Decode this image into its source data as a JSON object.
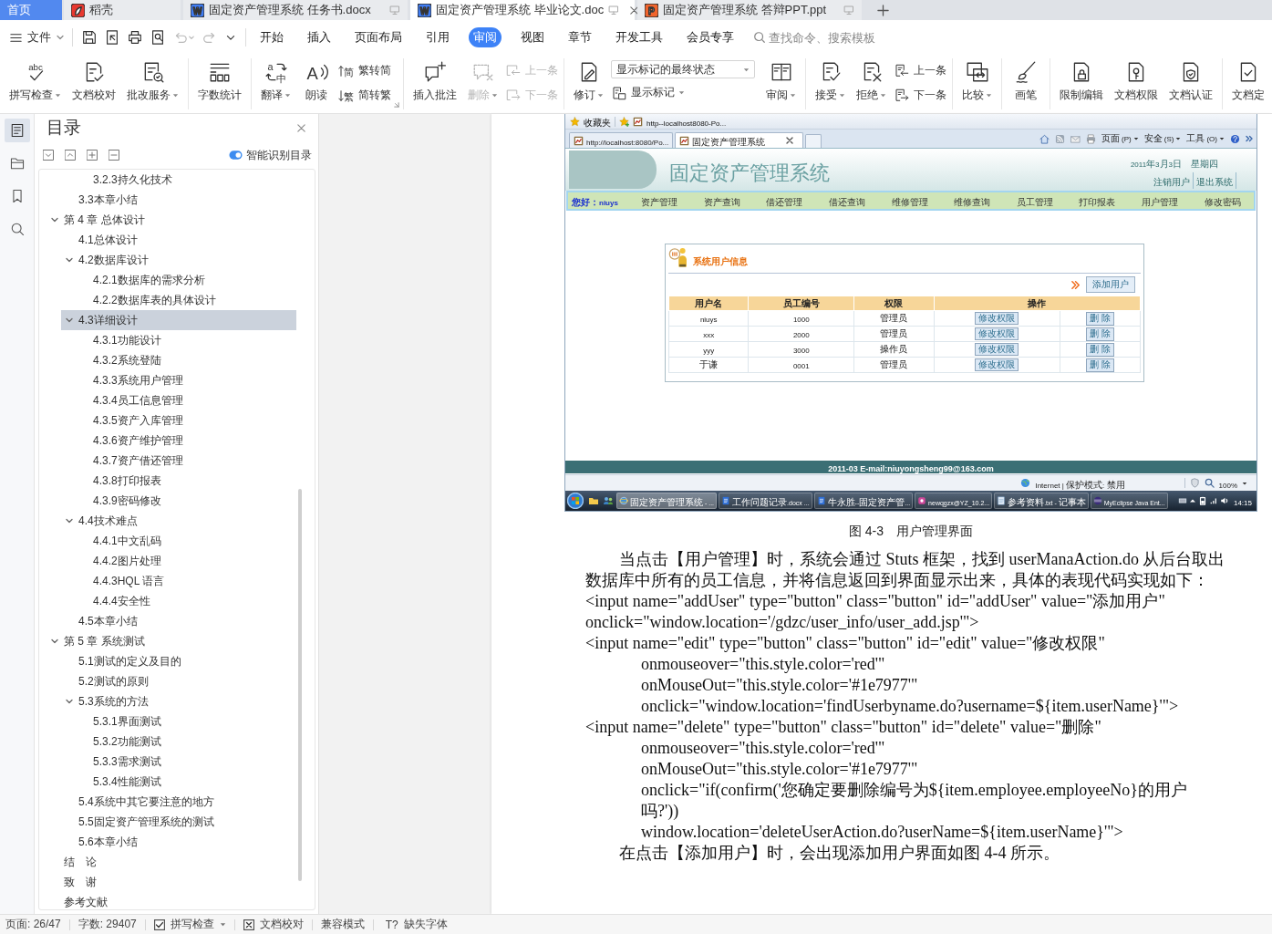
{
  "tabs": [
    {
      "label": "首页",
      "kind": "home",
      "selected": false
    },
    {
      "label": "稻壳",
      "kind": "docer",
      "selected": false
    },
    {
      "label": "固定资产管理系统 任务书.docx",
      "kind": "writer",
      "icon_text": "W",
      "selected": false
    },
    {
      "label": "固定资产管理系统 毕业论文.doc",
      "kind": "writer",
      "icon_text": "W",
      "selected": true
    },
    {
      "label": "固定资产管理系统 答辩PPT.ppt",
      "kind": "presentation",
      "icon_text": "P",
      "selected": false
    }
  ],
  "menu_bar": {
    "file_menu": "文件",
    "quick_access": [
      {
        "disabled": false
      },
      {
        "disabled": false
      },
      {
        "disabled": false
      },
      {
        "disabled": false
      },
      {
        "disabled": true
      },
      {
        "disabled": true
      }
    ],
    "menus": [
      {
        "label": "开始",
        "selected": false
      },
      {
        "label": "插入",
        "selected": false
      },
      {
        "label": "页面布局",
        "selected": false
      },
      {
        "label": "引用",
        "selected": false
      },
      {
        "label": "审阅",
        "selected": true
      },
      {
        "label": "视图",
        "selected": false
      },
      {
        "label": "章节",
        "selected": false
      },
      {
        "label": "开发工具",
        "selected": false
      },
      {
        "label": "会员专享",
        "selected": false
      }
    ],
    "search": {
      "placeholder": "查找命令、搜索模板"
    }
  },
  "ribbon": {
    "groups": [
      {
        "launcher": false,
        "items": [
          {
            "kind": "large",
            "label": "拼写检查",
            "glyphs": [
              "abc"
            ],
            "dropdown": true,
            "disabled": false
          },
          {
            "kind": "large",
            "label": "文档校对",
            "dropdown": false,
            "disabled": false
          },
          {
            "kind": "large",
            "label": "批改服务",
            "dropdown": true,
            "disabled": false
          }
        ]
      },
      {
        "launcher": false,
        "items": [
          {
            "kind": "large",
            "label": "字数统计",
            "dropdown": false,
            "disabled": false
          }
        ]
      },
      {
        "launcher": true,
        "items": [
          {
            "kind": "large",
            "label": "翻译",
            "glyphs": [
              "a",
              "中"
            ],
            "dropdown": true,
            "disabled": false
          },
          {
            "kind": "large",
            "label": "朗读",
            "glyphs": [
              "A"
            ],
            "dropdown": false,
            "disabled": false
          },
          {
            "kind": "stack",
            "buttons": [
              {
                "label": "繁转简",
                "glyphs": [
                  "简"
                ],
                "disabled": false
              },
              {
                "label": "简转繁",
                "glyphs": [
                  "繁"
                ],
                "disabled": false
              }
            ]
          }
        ]
      },
      {
        "launcher": false,
        "items": [
          {
            "kind": "large",
            "label": "插入批注",
            "dropdown": false,
            "disabled": false
          },
          {
            "kind": "large",
            "label": "删除",
            "dropdown": true,
            "disabled": true
          },
          {
            "kind": "stack",
            "buttons": [
              {
                "label": "上一条",
                "disabled": true
              },
              {
                "label": "下一条",
                "disabled": true
              }
            ]
          }
        ]
      },
      {
        "launcher": false,
        "items": [
          {
            "kind": "large",
            "label": "修订",
            "dropdown": true,
            "disabled": false
          },
          {
            "kind": "select",
            "value": "显示标记的最终状态",
            "button": {
              "label": "显示标记",
              "dropdown": true,
              "disabled": false
            }
          },
          {
            "kind": "large",
            "label": "审阅",
            "dropdown": true,
            "disabled": false
          }
        ]
      },
      {
        "launcher": false,
        "items": [
          {
            "kind": "large",
            "label": "接受",
            "dropdown": true,
            "disabled": false
          },
          {
            "kind": "large",
            "label": "拒绝",
            "dropdown": true,
            "disabled": false
          },
          {
            "kind": "stack",
            "buttons": [
              {
                "label": "上一条",
                "disabled": false
              },
              {
                "label": "下一条",
                "disabled": false
              }
            ]
          }
        ]
      },
      {
        "launcher": false,
        "items": [
          {
            "kind": "large",
            "label": "比较",
            "dropdown": true,
            "disabled": false
          }
        ]
      },
      {
        "launcher": false,
        "items": [
          {
            "kind": "large",
            "label": "画笔",
            "dropdown": false,
            "disabled": false
          }
        ]
      },
      {
        "launcher": false,
        "items": [
          {
            "kind": "large",
            "label": "限制编辑",
            "dropdown": false,
            "disabled": false
          },
          {
            "kind": "large",
            "label": "文档权限",
            "dropdown": false,
            "disabled": false
          },
          {
            "kind": "large",
            "label": "文档认证",
            "dropdown": false,
            "disabled": false
          }
        ]
      },
      {
        "launcher": false,
        "items": [
          {
            "kind": "large",
            "label": "文档定",
            "dropdown": false,
            "disabled": false
          }
        ]
      }
    ]
  },
  "nav_rail": [
    {
      "selected": true
    },
    {
      "selected": false
    },
    {
      "selected": false
    },
    {
      "selected": false
    }
  ],
  "toc": {
    "title": "目录",
    "smart_button": "智能识别目录",
    "items": [
      {
        "children": [
          {
            "children": [
              {
                "label": "3.2.3持久化技术",
                "selected": false
              }
            ]
          },
          {
            "label": "3.3本章小结",
            "selected": false
          }
        ]
      },
      {
        "label": "第 4 章 总体设计",
        "selected": false,
        "expanded": true,
        "children": [
          {
            "label": "4.1总体设计",
            "selected": false
          },
          {
            "label": "4.2数据库设计",
            "selected": false,
            "expanded": true,
            "children": [
              {
                "label": "4.2.1数据库的需求分析",
                "selected": false
              },
              {
                "label": "4.2.2数据库表的具体设计",
                "selected": false
              }
            ]
          },
          {
            "label": "4.3详细设计",
            "selected": true,
            "expanded": true,
            "children": [
              {
                "label": "4.3.1功能设计",
                "selected": false
              },
              {
                "label": "4.3.2系统登陆",
                "selected": false
              },
              {
                "label": "4.3.3系统用户管理",
                "selected": false
              },
              {
                "label": "4.3.4员工信息管理",
                "selected": false
              },
              {
                "label": "4.3.5资产入库管理",
                "selected": false
              },
              {
                "label": "4.3.6资产维护管理",
                "selected": false
              },
              {
                "label": "4.3.7资产借还管理",
                "selected": false
              },
              {
                "label": "4.3.8打印报表",
                "selected": false
              },
              {
                "label": "4.3.9密码修改",
                "selected": false
              }
            ]
          },
          {
            "label": "4.4技术难点",
            "selected": false,
            "expanded": true,
            "children": [
              {
                "label": "4.4.1中文乱码",
                "selected": false
              },
              {
                "label": "4.4.2图片处理",
                "selected": false
              },
              {
                "label": "4.4.3HQL 语言",
                "selected": false
              },
              {
                "label": "4.4.4安全性",
                "selected": false
              }
            ]
          },
          {
            "label": "4.5本章小结",
            "selected": false
          }
        ]
      },
      {
        "label": "第 5 章 系统测试",
        "selected": false,
        "expanded": true,
        "children": [
          {
            "label": "5.1测试的定义及目的",
            "selected": false
          },
          {
            "label": "5.2测试的原则",
            "selected": false
          },
          {
            "label": "5.3系统的方法",
            "selected": false,
            "expanded": true,
            "children": [
              {
                "label": "5.3.1界面测试",
                "selected": false
              },
              {
                "label": "5.3.2功能测试",
                "selected": false
              },
              {
                "label": "5.3.3需求测试",
                "selected": false
              },
              {
                "label": "5.3.4性能测试",
                "selected": false
              }
            ]
          },
          {
            "label": "5.4系统中其它要注意的地方",
            "selected": false
          },
          {
            "label": "5.5固定资产管理系统的测试",
            "selected": false
          },
          {
            "label": "5.6本章小结",
            "selected": false
          }
        ]
      },
      {
        "label": "结　论",
        "selected": false
      },
      {
        "label": "致　谢",
        "selected": false
      },
      {
        "label": "参考文献",
        "selected": false
      }
    ]
  },
  "document": {
    "figure": {
      "favorites": {
        "label": "收藏夹",
        "link": "http--localhost8080-Po..."
      },
      "browser_tabs": [
        {
          "label": "http://localhost:8080/Po...",
          "selected": false
        },
        {
          "label": "固定资产管理系统",
          "selected": true
        }
      ],
      "command_menus": [
        "页面(P)",
        "安全(S)",
        "工具(O)"
      ],
      "site": {
        "title": "固定资产管理系统",
        "date": "2011年3月3日",
        "weekday": "星期四",
        "links": [
          "注销用户",
          "退出系统"
        ],
        "greeting": "您好：niuys",
        "nav": [
          "资产管理",
          "资产查询",
          "借还管理",
          "借还查询",
          "维修管理",
          "维修查询",
          "员工管理",
          "打印报表",
          "用户管理",
          "修改密码"
        ],
        "panel": {
          "title": "系统用户信息",
          "add_button": "添加用户",
          "columns": [
            "用户名",
            "员工编号",
            "权限",
            "操作"
          ],
          "rows": [
            {
              "cells": [
                "niuys",
                "1000",
                "管理员"
              ],
              "actions": [
                "修改权限",
                "删 除"
              ]
            },
            {
              "cells": [
                "xxx",
                "2000",
                "管理员"
              ],
              "actions": [
                "修改权限",
                "删 除"
              ]
            },
            {
              "cells": [
                "yyy",
                "3000",
                "操作员"
              ],
              "actions": [
                "修改权限",
                "删 除"
              ]
            },
            {
              "cells": [
                "于谦",
                "0001",
                "管理员"
              ],
              "actions": [
                "修改权限",
                "删 除"
              ]
            }
          ]
        },
        "footer": "2011-03 E-mail:niuyongsheng99@163.com"
      },
      "status": {
        "zone": "Internet | 保护模式: 禁用",
        "zoom": "100%"
      },
      "taskbar": {
        "buttons": [
          {
            "label": "固定资产管理系统 - ...",
            "selected": true
          },
          {
            "label": "工作问题记录.docx ...",
            "selected": false
          },
          {
            "label": "牛永胜--固定资产管...",
            "selected": false
          },
          {
            "label": "newqgzx@YZ_10.2...",
            "selected": false
          },
          {
            "label": "参考资料.txt - 记事本",
            "selected": false
          },
          {
            "label": "MyEclipse Java Ent...",
            "selected": false
          }
        ],
        "clock": "14:15"
      }
    },
    "caption": "图 4-3　用户管理界面",
    "paragraphs": [
      {
        "lines": [
          {
            "kind": "indent",
            "text": "当点击【用户管理】时，系统会通过 Stuts 框架，找到 userManaAction.do 从后台取出"
          },
          {
            "kind": "flush",
            "text": "数据库中所有的员工信息，并将信息返回到界面显示出来，具体的表现代码实现如下："
          }
        ]
      },
      {
        "lines": [
          {
            "kind": "flush",
            "text": "<input name=\"addUser\" type=\"button\" class=\"button\" id=\"addUser\" value=\"添加用户\""
          },
          {
            "kind": "flush",
            "text": "onclick=\"window.location='/gdzc/user_info/user_add.jsp'\">"
          }
        ]
      },
      {
        "lines": [
          {
            "kind": "flush",
            "text": "<input name=\"edit\" type=\"button\" class=\"button\" id=\"edit\" value=\"修改权限\""
          },
          {
            "kind": "attr",
            "text": "onmouseover=\"this.style.color='red'\""
          },
          {
            "kind": "attr",
            "text": "onMouseOut=\"this.style.color='#1e7977'\""
          },
          {
            "kind": "attr",
            "text": "onclick=\"window.location='findUserbyname.do?username=${item.userName}'\">"
          }
        ]
      },
      {
        "lines": [
          {
            "kind": "flush",
            "text": "<input name=\"delete\" type=\"button\" class=\"button\" id=\"delete\" value=\"删除\""
          },
          {
            "kind": "attr",
            "text": "onmouseover=\"this.style.color='red'\""
          },
          {
            "kind": "attr",
            "text": "onMouseOut=\"this.style.color='#1e7977'\""
          },
          {
            "kind": "attr",
            "text": "onclick=\"if(confirm('您确定要删除编号为${item.employee.employeeNo}的用户"
          },
          {
            "kind": "attr",
            "text": "吗?'))"
          },
          {
            "kind": "attr",
            "text": "window.location='deleteUserAction.do?userName=${item.userName}'\">"
          }
        ]
      },
      {
        "lines": [
          {
            "kind": "indent",
            "text": "在点击【添加用户】时，会出现添加用户界面如图 4-4 所示。"
          }
        ]
      }
    ]
  },
  "status_bar": {
    "page": "页面: 26/47",
    "words": "字数: 29407",
    "spell_check": {
      "label": "拼写检查",
      "checked": true
    },
    "proofread": "文档校对",
    "compat": "兼容模式",
    "missing_fonts": {
      "icon": "T?",
      "label": "缺失字体"
    }
  }
}
